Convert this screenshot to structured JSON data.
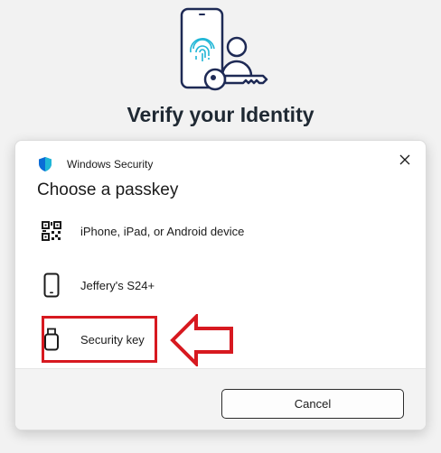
{
  "hero": {
    "title": "Verify your Identity"
  },
  "dialog": {
    "app_name": "Windows Security",
    "heading": "Choose a passkey",
    "options": [
      {
        "label": "iPhone, iPad, or Android device",
        "icon": "qr-code-icon"
      },
      {
        "label": "Jeffery's S24+",
        "icon": "phone-icon"
      },
      {
        "label": "Security key",
        "icon": "usb-key-icon"
      }
    ],
    "cancel_label": "Cancel",
    "close_icon": "close-icon"
  },
  "colors": {
    "accent_cyan": "#1fb6d6",
    "navy": "#1e2a55",
    "highlight_red": "#d71920",
    "shield_blue": "#0a6cd6"
  }
}
